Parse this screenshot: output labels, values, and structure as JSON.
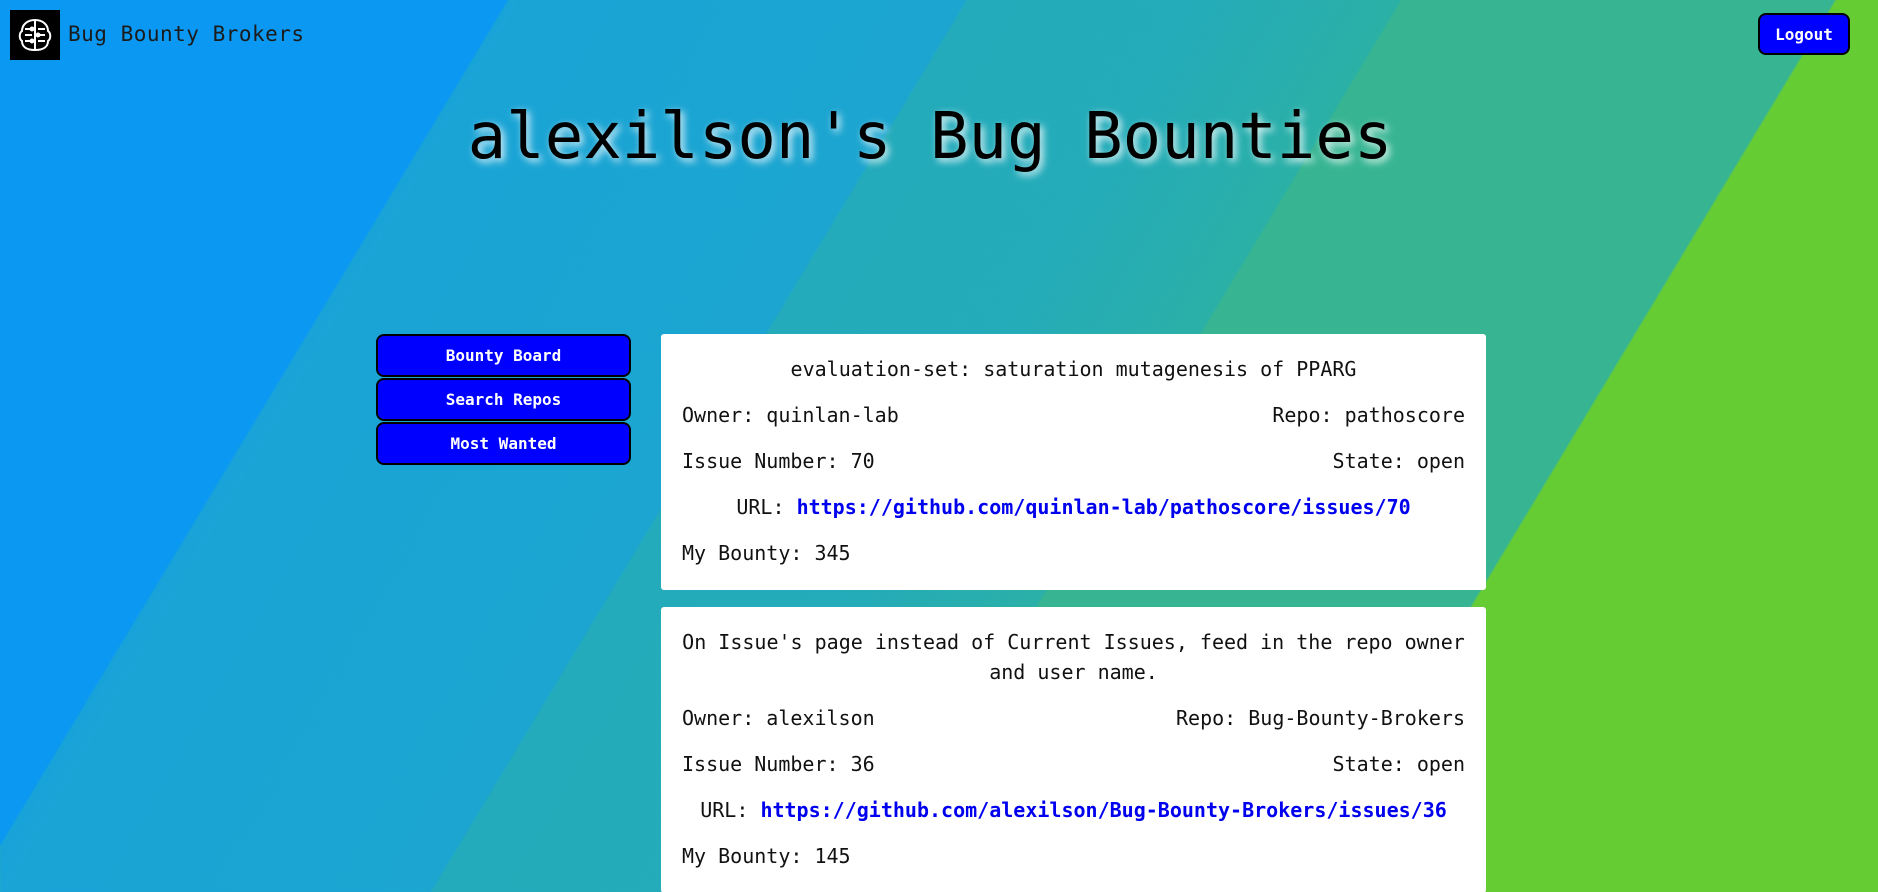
{
  "header": {
    "brand": "Bug Bounty Brokers",
    "logout_label": "Logout"
  },
  "page_title": "alexilson's Bug Bounties",
  "nav": {
    "items": [
      {
        "label": "Bounty Board"
      },
      {
        "label": "Search Repos"
      },
      {
        "label": "Most Wanted"
      }
    ]
  },
  "cards": [
    {
      "title": "evaluation-set: saturation mutagenesis of PPARG",
      "owner": "Owner: quinlan-lab",
      "repo": "Repo: pathoscore",
      "issue": "Issue Number: 70",
      "state": "State: open",
      "url_label": "URL:",
      "url": "https://github.com/quinlan-lab/pathoscore/issues/70",
      "bounty": "My Bounty: 345"
    },
    {
      "title": "On Issue's page instead of Current Issues, feed in the repo owner and user name.",
      "owner": "Owner: alexilson",
      "repo": "Repo: Bug-Bounty-Brokers",
      "issue": "Issue Number: 36",
      "state": "State: open",
      "url_label": "URL:",
      "url": "https://github.com/alexilson/Bug-Bounty-Brokers/issues/36",
      "bounty": "My Bounty: 145"
    }
  ],
  "colors": {
    "button": "#0000ff",
    "link": "#0000ee",
    "card": "#ffffff"
  }
}
